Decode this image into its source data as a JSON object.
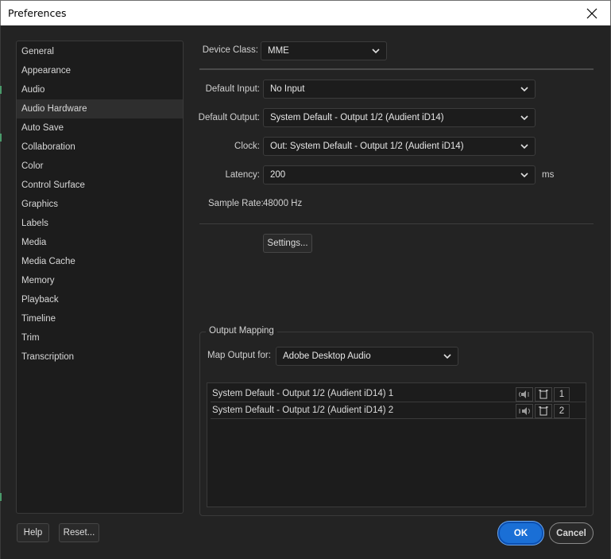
{
  "window": {
    "title": "Preferences"
  },
  "sidebar": {
    "items": [
      {
        "label": "General"
      },
      {
        "label": "Appearance"
      },
      {
        "label": "Audio"
      },
      {
        "label": "Audio Hardware",
        "selected": true
      },
      {
        "label": "Auto Save"
      },
      {
        "label": "Collaboration"
      },
      {
        "label": "Color"
      },
      {
        "label": "Control Surface"
      },
      {
        "label": "Graphics"
      },
      {
        "label": "Labels"
      },
      {
        "label": "Media"
      },
      {
        "label": "Media Cache"
      },
      {
        "label": "Memory"
      },
      {
        "label": "Playback"
      },
      {
        "label": "Timeline"
      },
      {
        "label": "Trim"
      },
      {
        "label": "Transcription"
      }
    ]
  },
  "form": {
    "device_class": {
      "label": "Device Class:",
      "value": "MME"
    },
    "default_input": {
      "label": "Default Input:",
      "value": "No Input"
    },
    "default_output": {
      "label": "Default Output:",
      "value": "System Default - Output 1/2 (Audient iD14)"
    },
    "clock": {
      "label": "Clock:",
      "value": "Out: System Default - Output 1/2 (Audient iD14)"
    },
    "latency": {
      "label": "Latency:",
      "value": "200",
      "unit": "ms"
    },
    "sample_rate": {
      "label": "Sample Rate:",
      "value": "48000 Hz"
    },
    "settings_button": "Settings..."
  },
  "output_mapping": {
    "title": "Output Mapping",
    "map_for_label": "Map Output for:",
    "map_for_value": "Adobe Desktop Audio",
    "rows": [
      {
        "name": "System Default - Output 1/2 (Audient iD14) 1",
        "channel": "1"
      },
      {
        "name": "System Default - Output 1/2 (Audient iD14) 2",
        "channel": "2"
      }
    ]
  },
  "footer": {
    "help": "Help",
    "reset": "Reset...",
    "ok": "OK",
    "cancel": "Cancel"
  },
  "colors": {
    "accent": "#1a6fd6",
    "background": "#232323",
    "panel": "#1c1c1c"
  }
}
